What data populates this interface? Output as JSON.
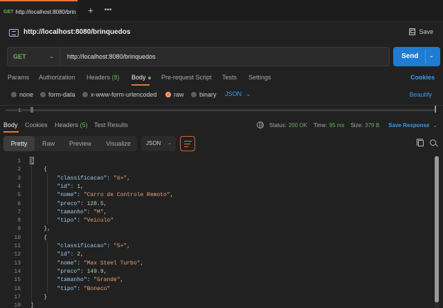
{
  "tab": {
    "method": "GET",
    "title": "http://localhost:8080/brin"
  },
  "request": {
    "name": "http://localhost:8080/brinquedos",
    "save_label": "Save",
    "method": "GET",
    "url": "http://localhost:8080/brinquedos",
    "send_label": "Send"
  },
  "request_tabs": {
    "params": "Params",
    "authorization": "Authorization",
    "headers": "Headers",
    "headers_count": "(8)",
    "body": "Body",
    "prerequest": "Pre-request Script",
    "tests": "Tests",
    "settings": "Settings",
    "cookies": "Cookies"
  },
  "body_types": {
    "none": "none",
    "form_data": "form-data",
    "urlencoded": "x-www-form-urlencoded",
    "raw": "raw",
    "binary": "binary",
    "format": "JSON",
    "beautify": "Beautify",
    "selected": "raw"
  },
  "editor": {
    "line": "1"
  },
  "response_tabs": {
    "body": "Body",
    "cookies": "Cookies",
    "headers": "Headers",
    "headers_count": "(5)",
    "test_results": "Test Results"
  },
  "status": {
    "status_label": "Status:",
    "status_value": "200 OK",
    "time_label": "Time:",
    "time_value": "95 ms",
    "size_label": "Size:",
    "size_value": "379 B",
    "save_response": "Save Response"
  },
  "view_modes": {
    "pretty": "Pretty",
    "raw": "Raw",
    "preview": "Preview",
    "visualize": "Visualize",
    "format": "JSON"
  },
  "response_lines": [
    {
      "n": "1",
      "t": "["
    },
    {
      "n": "2",
      "t": "    {"
    },
    {
      "n": "3",
      "k": "\"classificacao\"",
      "v": "\"6+\"",
      "vt": "s",
      "end": ","
    },
    {
      "n": "4",
      "k": "\"id\"",
      "v": "1",
      "vt": "num",
      "end": ","
    },
    {
      "n": "5",
      "k": "\"nome\"",
      "v": "\"Carro de Controle Remoto\"",
      "vt": "s",
      "end": ","
    },
    {
      "n": "6",
      "k": "\"preco\"",
      "v": "128.5",
      "vt": "num",
      "end": ","
    },
    {
      "n": "7",
      "k": "\"tamanho\"",
      "v": "\"M\"",
      "vt": "s",
      "end": ","
    },
    {
      "n": "8",
      "k": "\"tipo\"",
      "v": "\"Veiculo\"",
      "vt": "s",
      "end": ""
    },
    {
      "n": "9",
      "t": "    },"
    },
    {
      "n": "10",
      "t": "    {"
    },
    {
      "n": "11",
      "k": "\"classificacao\"",
      "v": "\"5+\"",
      "vt": "s",
      "end": ","
    },
    {
      "n": "12",
      "k": "\"id\"",
      "v": "2",
      "vt": "num",
      "end": ","
    },
    {
      "n": "13",
      "k": "\"nome\"",
      "v": "\"Max Steel Turbo\"",
      "vt": "s",
      "end": ","
    },
    {
      "n": "14",
      "k": "\"preco\"",
      "v": "149.9",
      "vt": "num",
      "end": ","
    },
    {
      "n": "15",
      "k": "\"tamanho\"",
      "v": "\"Grande\"",
      "vt": "s",
      "end": ","
    },
    {
      "n": "16",
      "k": "\"tipo\"",
      "v": "\"Boneco\"",
      "vt": "s",
      "end": ""
    },
    {
      "n": "17",
      "t": "    }"
    },
    {
      "n": "18",
      "t": "]"
    }
  ]
}
